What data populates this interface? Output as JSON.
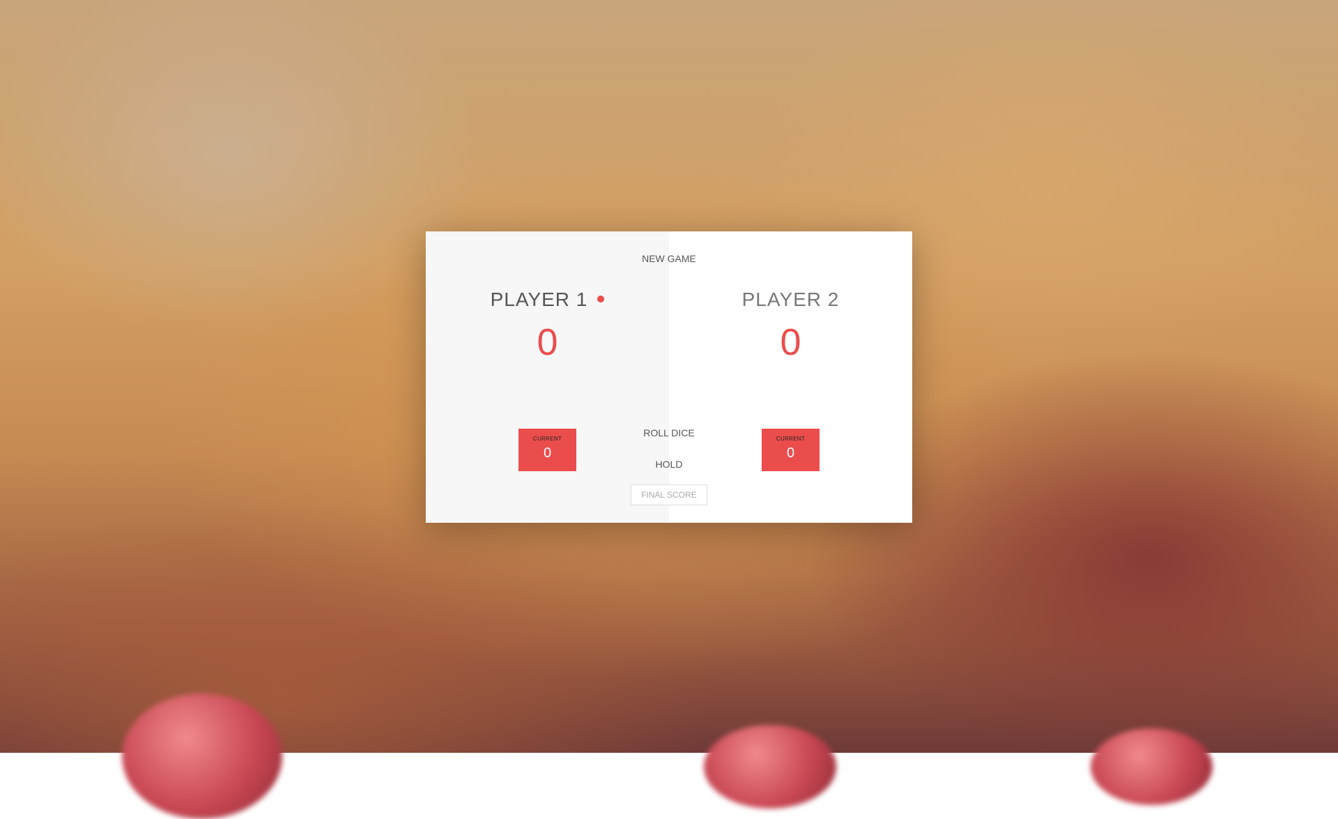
{
  "controls": {
    "new_game": "NEW GAME",
    "roll_dice": "ROLL DICE",
    "hold": "HOLD",
    "final_score_placeholder": "FINAL SCORE"
  },
  "players": [
    {
      "name": "PLAYER 1",
      "score": "0",
      "current_label": "CURRENT",
      "current_score": "0",
      "active": true
    },
    {
      "name": "PLAYER 2",
      "score": "0",
      "current_label": "CURRENT",
      "current_score": "0",
      "active": false
    }
  ],
  "colors": {
    "accent": "#eb4d4d",
    "active_panel": "#f7f7f7",
    "inactive_panel": "#ffffff"
  }
}
